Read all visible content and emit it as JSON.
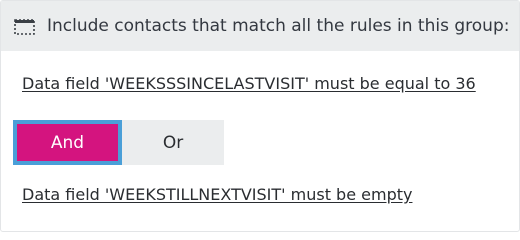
{
  "group": {
    "title": "Include contacts that match all the rules in this group:",
    "icon": "dashed-box-icon"
  },
  "rules": [
    {
      "text": "Data field 'WEEKSSSINCELASTVISIT' must be equal to 36"
    },
    {
      "text": "Data field 'WEEKSTILLNEXTVISIT' must be empty"
    }
  ],
  "operator_toggle": {
    "options": [
      "And",
      "Or"
    ],
    "selected": "And"
  },
  "colors": {
    "accent": "#d4147f",
    "focus_ring": "#4a9fd8",
    "header_bg": "#ebedee",
    "text": "#2a2d31"
  }
}
